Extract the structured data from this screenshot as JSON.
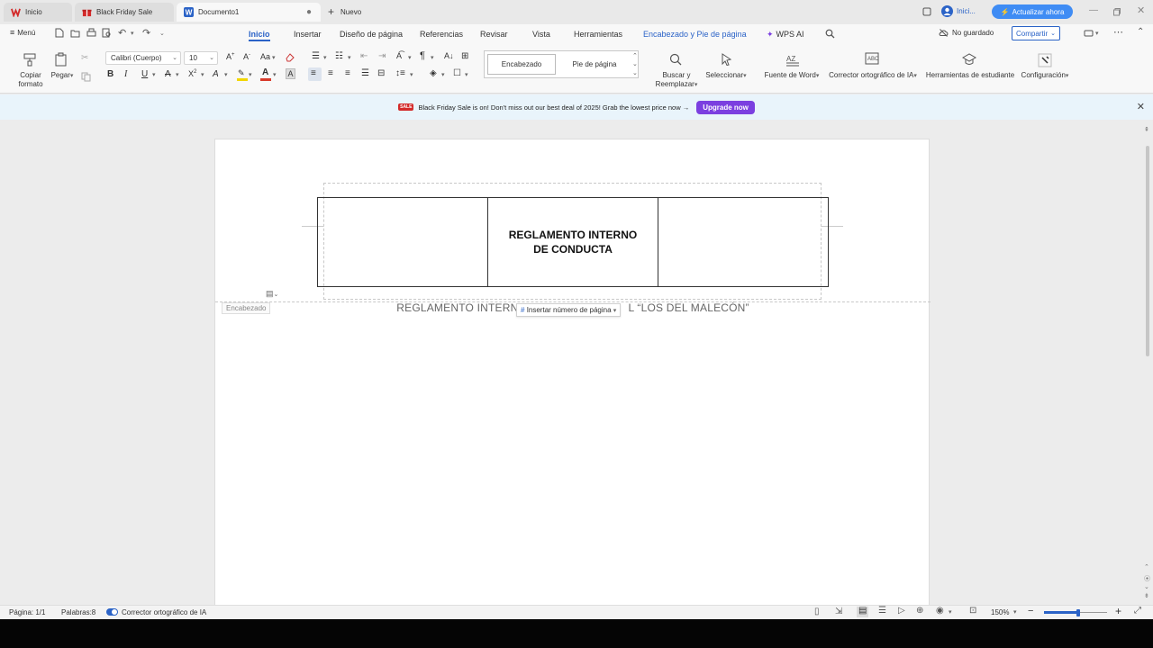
{
  "tabs": [
    {
      "label": "Inicio",
      "icon": "wps-logo-icon"
    },
    {
      "label": "Black Friday Sale",
      "icon": "gift-icon"
    },
    {
      "label": "Documento1",
      "icon": "word-doc-icon"
    }
  ],
  "new_tab_label": "Nuevo",
  "menu": {
    "menu_label": "Menú",
    "tabs": [
      "Inicio",
      "Insertar",
      "Diseño de página",
      "Referencias",
      "Revisar",
      "Vista",
      "Herramientas",
      "Encabezado y  Pie de página",
      "WPS AI"
    ],
    "active_tab": "Inicio",
    "account_label": "Inici...",
    "upgrade_label": "Actualizar ahora",
    "save_status": "No guardado",
    "share_label": "Compartir"
  },
  "ribbon": {
    "copy_format": "Copiar formato",
    "paste": "Pegar",
    "font_name": "Calibri (Cuerpo)",
    "font_size": "10",
    "style_header": "Encabezado",
    "style_footer": "Pie de página",
    "find_replace": "Buscar y Reemplazar",
    "select": "Seleccionar",
    "word_font": "Fuente de Word",
    "ai_spellcheck": "Corrector ortográfico de IA",
    "student_tools": "Herramientas de estudiante",
    "settings": "Configuración"
  },
  "banner": {
    "badge": "SALE",
    "text": "Black Friday Sale is on! Don't miss out our best deal of 2025! Grab the lowest price now →",
    "button": "Upgrade now"
  },
  "document": {
    "header_title": "REGLAMENTO INTERNO DE CONDUCTA",
    "header_tag": "Encabezado",
    "insert_page_number": "Insertar número de página",
    "body_text_left": "REGLAMENTO INTERN",
    "body_text_right": "L “LOS DEL MALECÓN”"
  },
  "status": {
    "page": "Página: 1/1",
    "words": "Palabras:8",
    "ai_spellcheck": "Corrector ortográfico de IA",
    "zoom": "150%"
  },
  "colors": {
    "accent": "#2b63c7",
    "upgrade_purple": "#7b3fe0",
    "banner_bg": "#e9f4fb",
    "font_color_red": "#d83b2b",
    "highlight_yellow": "#f2d600",
    "wps_red": "#d32a2a"
  }
}
